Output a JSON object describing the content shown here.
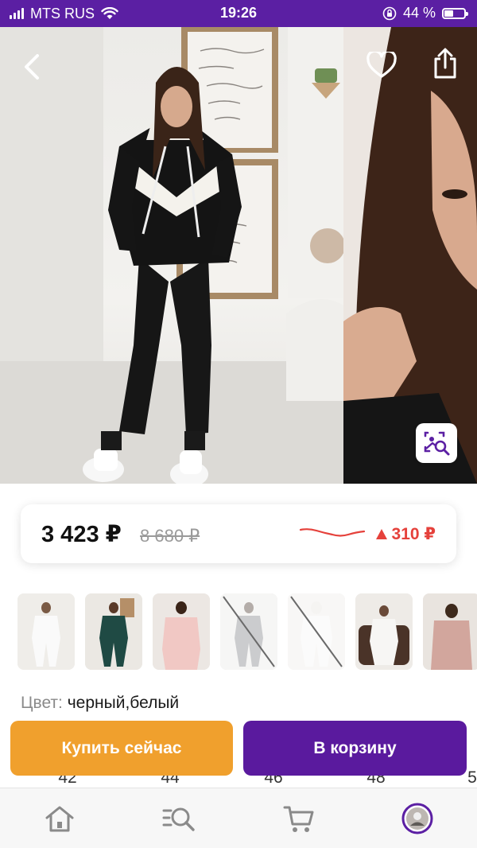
{
  "status_bar": {
    "carrier": "MTS RUS",
    "time": "19:26",
    "battery": "44 %",
    "battery_level": 0.44
  },
  "gallery": {
    "back_icon": "chevron-left-icon",
    "favorite_icon": "heart-icon",
    "share_icon": "share-icon",
    "zoom_icon": "image-search-icon"
  },
  "price": {
    "current": "3 423 ₽",
    "old": "8 680 ₽",
    "change": "310 ₽",
    "change_color": "#e5413b"
  },
  "thumbnails": [
    {
      "name": "white",
      "available": true
    },
    {
      "name": "green",
      "available": true
    },
    {
      "name": "pink",
      "available": true
    },
    {
      "name": "grey",
      "available": false
    },
    {
      "name": "white-hood",
      "available": false
    },
    {
      "name": "white-sofa",
      "available": true
    },
    {
      "name": "dusty-pink",
      "available": true
    }
  ],
  "color": {
    "label": "Цвет:",
    "value": "черный,белый"
  },
  "sizes": [
    "42",
    "44",
    "46",
    "48",
    "5"
  ],
  "actions": {
    "buy_now": "Купить сейчас",
    "add_to_cart": "В корзину",
    "buy_color": "#f0a02d",
    "cart_color": "#5a1a9e"
  },
  "tab_bar": {
    "items": [
      "home-icon",
      "catalog-search-icon",
      "cart-icon",
      "profile-avatar"
    ],
    "active_color": "#5b1fa3"
  }
}
